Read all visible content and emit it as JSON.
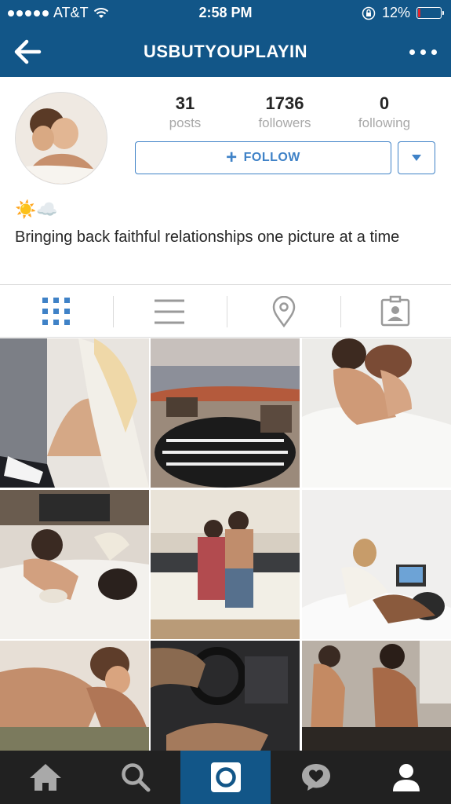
{
  "status_bar": {
    "carrier": "AT&T",
    "time": "2:58 PM",
    "battery": "12%",
    "battery_level": 0.12
  },
  "header": {
    "title": "USBUTYOUPLAYIN",
    "back_icon": "back-arrow-icon",
    "more_icon": "more-dots-icon"
  },
  "profile": {
    "stats": [
      {
        "value": "31",
        "label": "posts"
      },
      {
        "value": "1736",
        "label": "followers"
      },
      {
        "value": "0",
        "label": "following"
      }
    ],
    "follow_label": "FOLLOW",
    "emojis": "☀️☁️",
    "bio": "Bringing back faithful relationships one picture at a time"
  },
  "view_tabs": [
    {
      "icon": "grid-icon",
      "active": true
    },
    {
      "icon": "list-icon",
      "active": false
    },
    {
      "icon": "location-pin-icon",
      "active": false
    },
    {
      "icon": "tagged-photos-icon",
      "active": false
    }
  ],
  "colors": {
    "header_bg": "#125688",
    "accent": "#3f82c7",
    "bottom_bar": "#212121"
  },
  "bottom_nav": [
    {
      "icon": "home-icon",
      "active": false
    },
    {
      "icon": "search-icon",
      "active": false
    },
    {
      "icon": "camera-icon",
      "active": true
    },
    {
      "icon": "activity-icon",
      "active": false
    },
    {
      "icon": "profile-icon",
      "active": false
    }
  ]
}
